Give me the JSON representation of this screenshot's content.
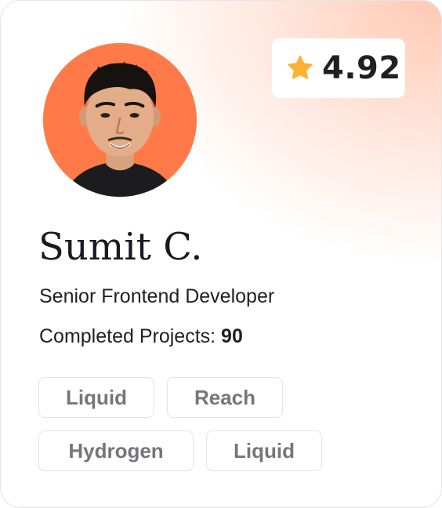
{
  "profile": {
    "name": "Sumit C.",
    "role": "Senior Frontend Developer",
    "projects_label": "Completed Projects:",
    "projects_count": "90",
    "rating": "4.92",
    "rating_icon": "star-icon"
  },
  "tags": [
    "Liquid",
    "Reach",
    "Hydrogen",
    "Liquid"
  ],
  "colors": {
    "avatar_background": "#ff7a48",
    "star": "#fbb131",
    "gradient_accent": "#ffc9b3",
    "tag_text": "#75757c"
  }
}
